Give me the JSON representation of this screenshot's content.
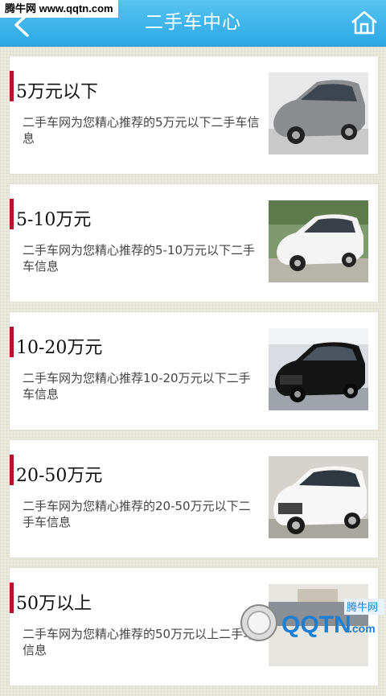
{
  "watermark": "腾牛网 www.qqtn.com",
  "header": {
    "title": "二手车中心"
  },
  "items": [
    {
      "name": "5万元以下",
      "desc": "二手车网为您精心推荐的5万元以下二手车信息"
    },
    {
      "name": "5-10万元",
      "desc": "二手车网为您精心推荐的5-10万元以下二手车信息"
    },
    {
      "name": "10-20万元",
      "desc": "二手车网为您精心推荐10-20万元以下二手车信息"
    },
    {
      "name": "20-50万元",
      "desc": "二手车网为您精心推荐的20-50万元以下二手车信息"
    },
    {
      "name": "50万以上",
      "desc": "二手车网为您精心推荐的50万元以上二手车信息"
    }
  ],
  "footer_logo": {
    "text": "QQTN",
    "suffix": ".com",
    "badge": "腾牛网"
  },
  "colors": {
    "header": "#2da8e3",
    "accent_bar": "#b3172d"
  }
}
